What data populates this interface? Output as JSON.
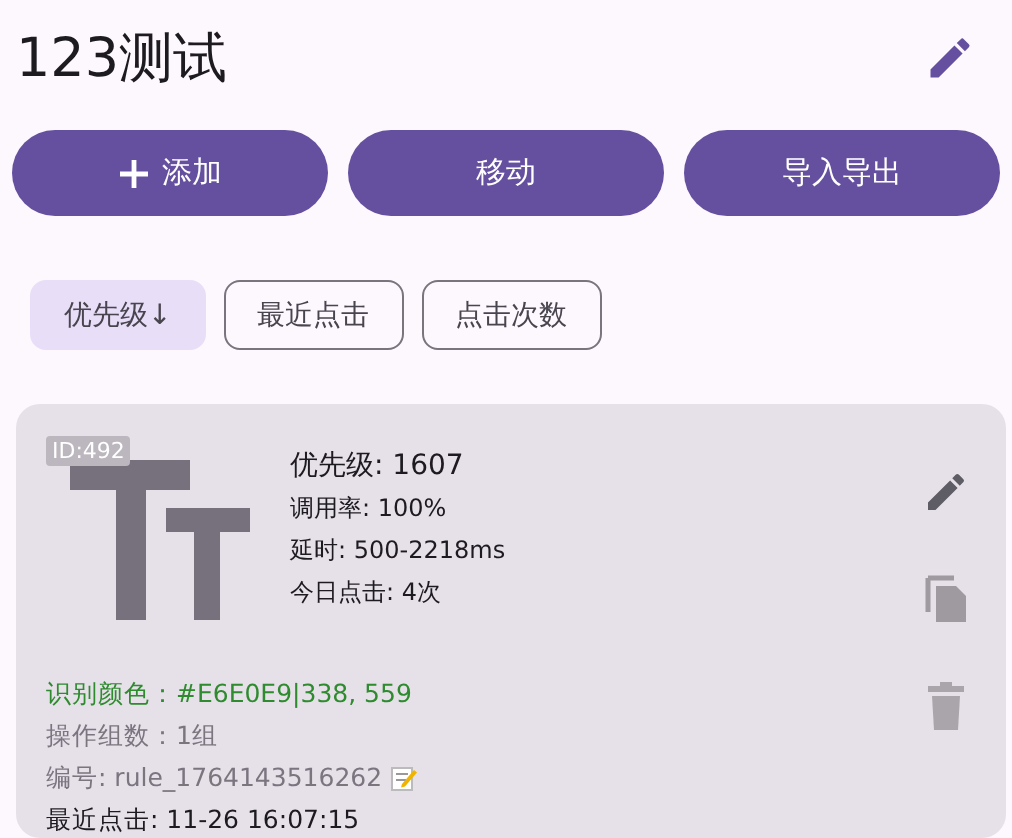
{
  "title": "123测试",
  "actions": [
    {
      "kind": "add",
      "label": "添加"
    },
    {
      "kind": "plain",
      "label": "移动"
    },
    {
      "kind": "plain",
      "label": "导入导出"
    }
  ],
  "sort_options": [
    {
      "label": "优先级↓",
      "selected": true
    },
    {
      "label": "最近点击",
      "selected": false
    },
    {
      "label": "点击次数",
      "selected": false
    }
  ],
  "rule_card": {
    "id_badge": "ID:492",
    "priority": "优先级: 1607",
    "stats": [
      "调用率: 100%",
      "延时: 500-2218ms",
      "今日点击: 4次"
    ],
    "details": [
      {
        "kind": "color",
        "text": "识别颜色：#E6E0E9|338, 559"
      },
      {
        "kind": "muted",
        "text": "操作组数：1组"
      },
      {
        "kind": "editable",
        "text": "编号: rule_1764143516262"
      },
      {
        "kind": "normal",
        "text": "最近点击: 11-26 16:07:15"
      }
    ]
  }
}
